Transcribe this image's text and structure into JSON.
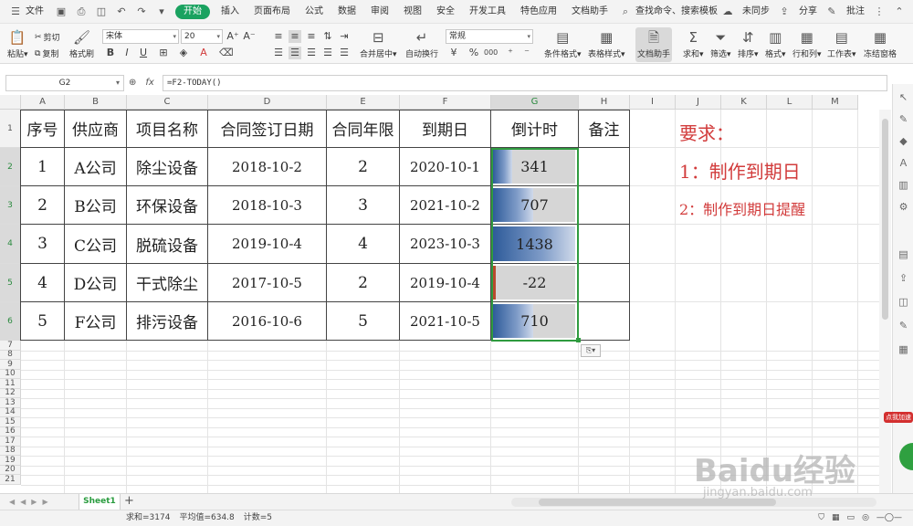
{
  "menubar": {
    "file": "文件",
    "tabs": [
      "开始",
      "插入",
      "页面布局",
      "公式",
      "数据",
      "审阅",
      "视图",
      "安全",
      "开发工具",
      "特色应用",
      "文档助手"
    ],
    "active_tab": "开始",
    "search": "查找命令、搜索模板",
    "right": [
      "未同步",
      "分享",
      "批注"
    ]
  },
  "ribbon": {
    "paste": "粘贴",
    "cut": "剪切",
    "copy": "复制",
    "format_painter": "格式刷",
    "font_name": "宋体",
    "font_size": "20",
    "bold": "B",
    "italic": "I",
    "underline": "U",
    "grow": "A⁺",
    "shrink": "A⁻",
    "merge": "合并居中",
    "wrap": "自动换行",
    "number_format": "常规",
    "percent": "%",
    "thousands": "000",
    "cond_format": "条件格式",
    "table_style": "表格样式",
    "doc_assistant": "文档助手",
    "sum": "求和",
    "filter": "筛选",
    "sort": "排序",
    "format": "格式",
    "rowcol": "行和列",
    "sheet": "工作表",
    "freeze": "冻结窗格"
  },
  "formula_bar": {
    "cell_ref": "G2",
    "fx": "fx",
    "formula": "=F2-TODAY()"
  },
  "columns": [
    "A",
    "B",
    "C",
    "D",
    "E",
    "F",
    "G",
    "H",
    "I",
    "J",
    "K",
    "L",
    "M"
  ],
  "rows": [
    "1",
    "2",
    "3",
    "4",
    "5",
    "6",
    "7",
    "8",
    "9",
    "10",
    "11",
    "12",
    "13",
    "14",
    "15",
    "16",
    "17",
    "18",
    "19",
    "20",
    "21"
  ],
  "table": {
    "headers": [
      "序号",
      "供应商",
      "项目名称",
      "合同签订日期",
      "合同年限",
      "到期日",
      "倒计时",
      "备注"
    ],
    "rows": [
      [
        "1",
        "A公司",
        "除尘设备",
        "2018-10-2",
        "2",
        "2020-10-1",
        "341",
        ""
      ],
      [
        "2",
        "B公司",
        "环保设备",
        "2018-10-3",
        "3",
        "2021-10-2",
        "707",
        ""
      ],
      [
        "3",
        "C公司",
        "脱硫设备",
        "2019-10-4",
        "4",
        "2023-10-3",
        "1438",
        ""
      ],
      [
        "4",
        "D公司",
        "干式除尘",
        "2017-10-5",
        "2",
        "2019-10-4",
        "-22",
        ""
      ],
      [
        "5",
        "F公司",
        "排污设备",
        "2016-10-6",
        "5",
        "2021-10-5",
        "710",
        ""
      ]
    ],
    "countdown_values": [
      341,
      707,
      1438,
      -22,
      710
    ],
    "bar_max": 1438
  },
  "requirements": {
    "title": "要求：",
    "item1": "1：制作到期日",
    "item2": "2：制作到期日提醒"
  },
  "sheet_tabs": {
    "active": "Sheet1",
    "add": "+"
  },
  "status": {
    "sum": "求和=3174",
    "avg": "平均值=634.8",
    "count": "计数=5"
  },
  "watermark": {
    "main": "Baidu经验",
    "sub": "jingyan.baidu.com",
    "badge": "点我加速"
  },
  "colors": {
    "accent": "#1aa260",
    "selection": "#2f9b3f",
    "requirement": "#d23c3c",
    "bar": "#2e5b9a"
  }
}
